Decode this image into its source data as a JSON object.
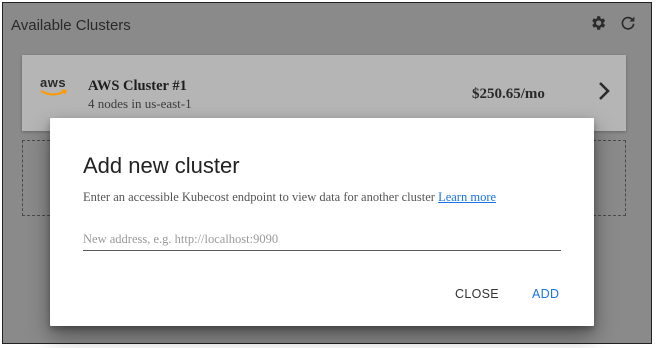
{
  "header": {
    "title": "Available Clusters",
    "icons": [
      "settings-gear-icon",
      "refresh-icon"
    ]
  },
  "clusters": [
    {
      "provider_logo": "aws",
      "name": "AWS Cluster #1",
      "details": "4 nodes in us-east-1",
      "cost": "$250.65/mo"
    }
  ],
  "dialog": {
    "title": "Add new cluster",
    "description": "Enter an accessible Kubecost endpoint to view data for another cluster",
    "learn_more": "Learn more",
    "input_placeholder": "New address, e.g. http://localhost:9090",
    "input_value": "",
    "close_label": "CLOSE",
    "add_label": "ADD"
  },
  "colors": {
    "accent": "#1a73e8",
    "aws_orange": "#ff9900"
  }
}
